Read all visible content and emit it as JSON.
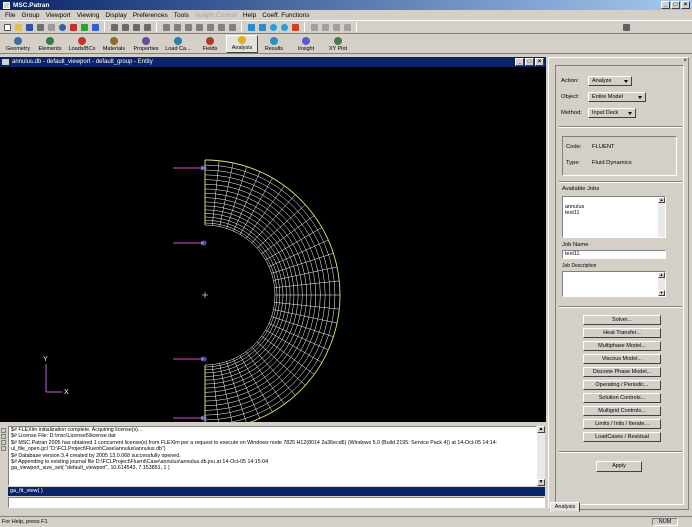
{
  "window": {
    "title": "MSC.Patran"
  },
  "menu": [
    "File",
    "Group",
    "Viewport",
    "Viewing",
    "Display",
    "Preferences",
    "Tools",
    "Insight Control",
    "Help",
    "Coeff. Functions"
  ],
  "menu_disabled_index": 7,
  "apps": [
    {
      "label": "Geometry",
      "icon": "geometry-icon",
      "color": "#3a6ea5"
    },
    {
      "label": "Elements",
      "icon": "elements-icon",
      "color": "#2f7d4a"
    },
    {
      "label": "Loads/BCs",
      "icon": "loads-bcs-icon",
      "color": "#c0392b"
    },
    {
      "label": "Materials",
      "icon": "materials-icon",
      "color": "#8e6c2a"
    },
    {
      "label": "Properties",
      "icon": "properties-icon",
      "color": "#6a4a9c"
    },
    {
      "label": "Load Ca...",
      "icon": "load-cases-icon",
      "color": "#2a7fb0"
    },
    {
      "label": "Fields",
      "icon": "fields-icon",
      "color": "#b03a2a"
    },
    {
      "label": "Analysis",
      "icon": "analysis-icon",
      "color": "#e0b020"
    },
    {
      "label": "Results",
      "icon": "results-icon",
      "color": "#2a90c0"
    },
    {
      "label": "Insight",
      "icon": "insight-icon",
      "color": "#5a5ad0"
    },
    {
      "label": "XY Plot",
      "icon": "xy-plot-icon",
      "color": "#4a7a4a"
    }
  ],
  "active_app": "Analysis",
  "viewport": {
    "title": "annulus.db - default_viewport - default_group - Entity"
  },
  "axes": {
    "y": "Y",
    "x": "X"
  },
  "history": [
    "$# FLEXlm initialization complete.  Acquiring license(s)...",
    "$# License File: D:\\msc\\License5\\license.dat",
    "$# MSC.Patran 2005 has obtained 1 concurrent license(s) from FLEXlm per a request to execute on Windows node 7825 H12(8014 2a36ecd6) (Windows 5.0 (Build 2195: Service Pack 4)) at 14-Oct-05 14:14:",
    "ul_file_open.gcl \"D:\\FCLProject\\Fluent\\Case\\annulus\\annulus.db\")",
    "$# Database version 3.4 created by 2005 13.0.068 successfully opened.",
    "$# Appending to existing journal file D:\\FCLProject\\Fluent\\Case\\annulus\\annulus.db.jou at 14-Oct-05 14:15:04",
    "ga_viewport_size_set( \"default_viewport\", 10.614543, 7.153851, 1 )"
  ],
  "command_line": "ga_fit_view( )",
  "status": {
    "message": "For Help, press F1",
    "num": "NUM"
  },
  "panel": {
    "action_label": "Action:",
    "action_value": "Analyze",
    "object_label": "Object:",
    "object_value": "Entire Model",
    "method_label": "Method:",
    "method_value": "Input Deck",
    "code_label": "Code:",
    "code_value": "FLUENT",
    "type_label": "Type:",
    "type_value": "Fluid Dynamics",
    "available_jobs_label": "Available Jobs",
    "jobs": [
      "annulus",
      "test11"
    ],
    "job_name_label": "Job Name",
    "job_name_value": "test11",
    "job_description_label": "Job Description",
    "buttons": [
      "Solver...",
      "Heat Transfer...",
      "Multiphase Model...",
      "Viscous Model...",
      "Discrete Phase Model...",
      "Operating / Periodic...",
      "Solution Controls...",
      "Multigrid Controls...",
      "Limits / Inits / Iterate...",
      "LoadCases / Residual"
    ],
    "apply_label": "Apply",
    "tab_label": "Analysis"
  }
}
